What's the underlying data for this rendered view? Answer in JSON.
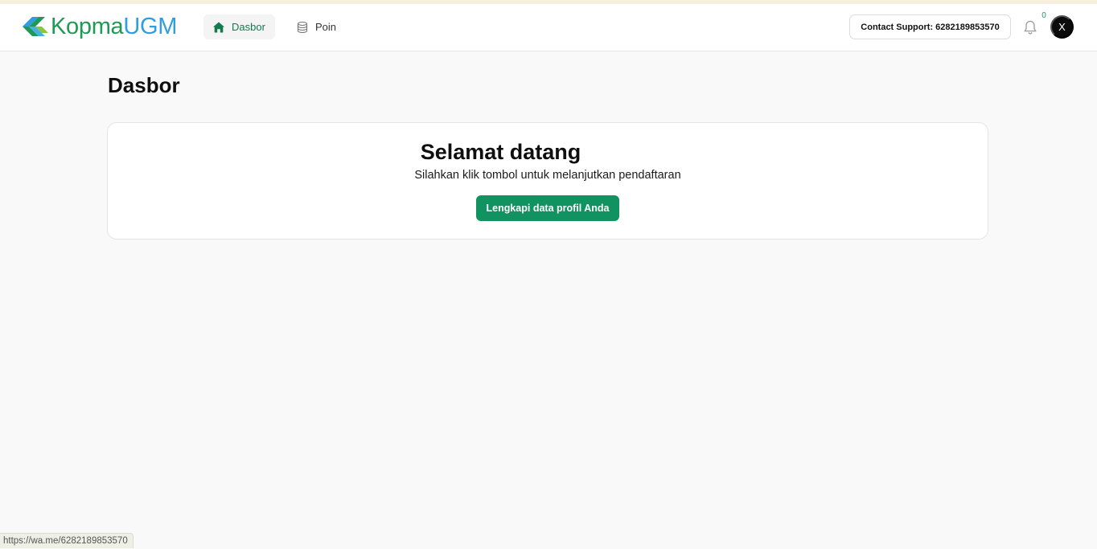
{
  "brand": {
    "name_part1": "Kopma",
    "name_part2": "UGM",
    "logo_colors": {
      "primary": "#1e9a55",
      "secondary": "#2f9ee0",
      "accent": "#8cc63f"
    }
  },
  "nav": {
    "items": [
      {
        "label": "Dasbor",
        "icon": "home-icon",
        "active": true
      },
      {
        "label": "Poin",
        "icon": "database-icon",
        "active": false
      }
    ]
  },
  "header": {
    "support_label": "Contact Support: 6282189853570",
    "notification_count": "0",
    "avatar_initial": "X"
  },
  "page": {
    "title": "Dasbor"
  },
  "welcome": {
    "title": "Selamat datang",
    "subtitle": "Silahkan klik tombol untuk melanjutkan pendaftaran",
    "cta_label": "Lengkapi data profil Anda"
  },
  "status_bar": {
    "url": "https://wa.me/6282189853570"
  },
  "colors": {
    "accent": "#119361",
    "background": "#f9f9f9",
    "active_nav_bg": "#f3f4f3"
  }
}
